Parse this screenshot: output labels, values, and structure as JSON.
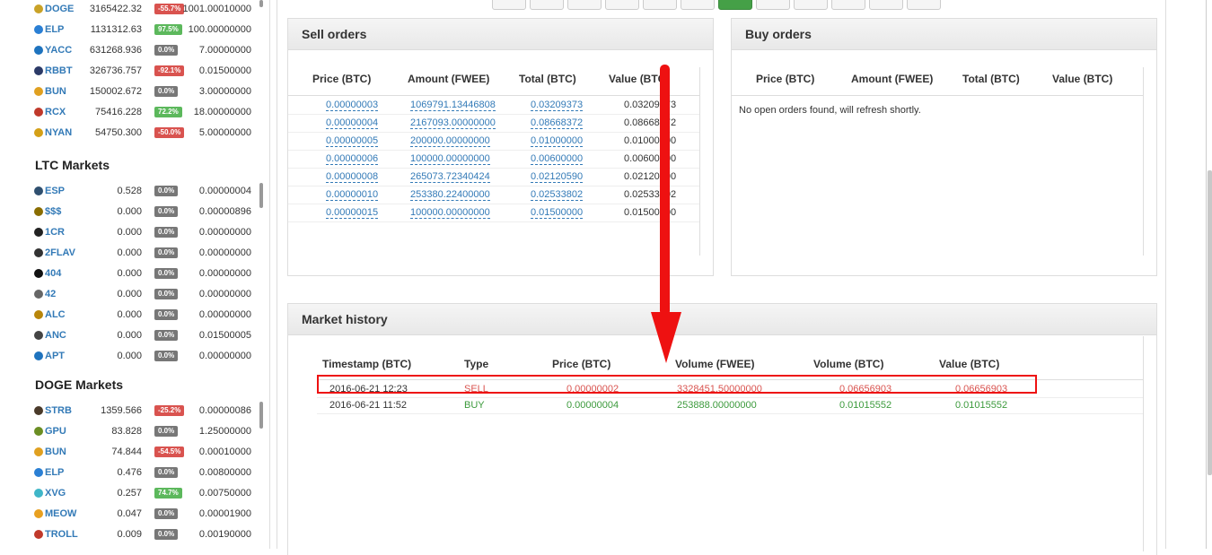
{
  "btc_markets": [
    {
      "symbol": "DOGE",
      "volume": "3165422.32",
      "change": "-55.7%",
      "change_color": "#d9534f",
      "price": "1001.00010000",
      "icon_color": "#c9a227"
    },
    {
      "symbol": "ELP",
      "volume": "1131312.63",
      "change": "97.5%",
      "change_color": "#5cb85c",
      "price": "100.00000000",
      "icon_color": "#2a7fd4"
    },
    {
      "symbol": "YACC",
      "volume": "631268.936",
      "change": "0.0%",
      "change_color": "#777777",
      "price": "7.00000000",
      "icon_color": "#1e73be"
    },
    {
      "symbol": "RBBT",
      "volume": "326736.757",
      "change": "-92.1%",
      "change_color": "#d9534f",
      "price": "0.01500000",
      "icon_color": "#2b3a67"
    },
    {
      "symbol": "BUN",
      "volume": "150002.672",
      "change": "0.0%",
      "change_color": "#777777",
      "price": "3.00000000",
      "icon_color": "#e0a020"
    },
    {
      "symbol": "RCX",
      "volume": "75416.228",
      "change": "72.2%",
      "change_color": "#5cb85c",
      "price": "18.00000000",
      "icon_color": "#c0392b"
    },
    {
      "symbol": "NYAN",
      "volume": "54750.300",
      "change": "-50.0%",
      "change_color": "#d9534f",
      "price": "5.00000000",
      "icon_color": "#d4a017"
    }
  ],
  "ltc_title": "LTC Markets",
  "ltc_markets": [
    {
      "symbol": "ESP",
      "volume": "0.528",
      "change": "0.0%",
      "change_color": "#777777",
      "price": "0.00000004",
      "icon_color": "#2f4f6f"
    },
    {
      "symbol": "$$$",
      "volume": "0.000",
      "change": "0.0%",
      "change_color": "#777777",
      "price": "0.00000896",
      "icon_color": "#8a6d00"
    },
    {
      "symbol": "1CR",
      "volume": "0.000",
      "change": "0.0%",
      "change_color": "#777777",
      "price": "0.00000000",
      "icon_color": "#222222"
    },
    {
      "symbol": "2FLAV",
      "volume": "0.000",
      "change": "0.0%",
      "change_color": "#777777",
      "price": "0.00000000",
      "icon_color": "#333333"
    },
    {
      "symbol": "404",
      "volume": "0.000",
      "change": "0.0%",
      "change_color": "#777777",
      "price": "0.00000000",
      "icon_color": "#111111"
    },
    {
      "symbol": "42",
      "volume": "0.000",
      "change": "0.0%",
      "change_color": "#777777",
      "price": "0.00000000",
      "icon_color": "#666666"
    },
    {
      "symbol": "ALC",
      "volume": "0.000",
      "change": "0.0%",
      "change_color": "#777777",
      "price": "0.00000000",
      "icon_color": "#b8860b"
    },
    {
      "symbol": "ANC",
      "volume": "0.000",
      "change": "0.0%",
      "change_color": "#777777",
      "price": "0.01500005",
      "icon_color": "#444444"
    },
    {
      "symbol": "APT",
      "volume": "0.000",
      "change": "0.0%",
      "change_color": "#777777",
      "price": "0.00000000",
      "icon_color": "#1e73be"
    }
  ],
  "doge_title": "DOGE Markets",
  "doge_markets": [
    {
      "symbol": "STRB",
      "volume": "1359.566",
      "change": "-25.2%",
      "change_color": "#d9534f",
      "price": "0.00000086",
      "icon_color": "#4a3a2a"
    },
    {
      "symbol": "GPU",
      "volume": "83.828",
      "change": "0.0%",
      "change_color": "#777777",
      "price": "1.25000000",
      "icon_color": "#6b8e23"
    },
    {
      "symbol": "BUN",
      "volume": "74.844",
      "change": "-54.5%",
      "change_color": "#d9534f",
      "price": "0.00010000",
      "icon_color": "#e0a020"
    },
    {
      "symbol": "ELP",
      "volume": "0.476",
      "change": "0.0%",
      "change_color": "#777777",
      "price": "0.00800000",
      "icon_color": "#2a7fd4"
    },
    {
      "symbol": "XVG",
      "volume": "0.257",
      "change": "74.7%",
      "change_color": "#5cb85c",
      "price": "0.00750000",
      "icon_color": "#3fb6c8"
    },
    {
      "symbol": "MEOW",
      "volume": "0.047",
      "change": "0.0%",
      "change_color": "#777777",
      "price": "0.00001900",
      "icon_color": "#e8a020"
    },
    {
      "symbol": "TROLL",
      "volume": "0.009",
      "change": "0.0%",
      "change_color": "#777777",
      "price": "0.00190000",
      "icon_color": "#c0392b"
    }
  ],
  "sell_orders": {
    "title": "Sell orders",
    "headers": [
      "Price (BTC)",
      "Amount (FWEE)",
      "Total (BTC)",
      "Value (BTC)"
    ],
    "rows": [
      [
        "0.00000003",
        "1069791.13446808",
        "0.03209373",
        "0.03209373"
      ],
      [
        "0.00000004",
        "2167093.00000000",
        "0.08668372",
        "0.08668372"
      ],
      [
        "0.00000005",
        "200000.00000000",
        "0.01000000",
        "0.01000000"
      ],
      [
        "0.00000006",
        "100000.00000000",
        "0.00600000",
        "0.00600000"
      ],
      [
        "0.00000008",
        "265073.72340424",
        "0.02120590",
        "0.02120590"
      ],
      [
        "0.00000010",
        "253380.22400000",
        "0.02533802",
        "0.02533802"
      ],
      [
        "0.00000015",
        "100000.00000000",
        "0.01500000",
        "0.01500000"
      ]
    ]
  },
  "buy_orders": {
    "title": "Buy orders",
    "headers": [
      "Price (BTC)",
      "Amount (FWEE)",
      "Total (BTC)",
      "Value (BTC)"
    ],
    "empty_message": "No open orders found, will refresh shortly."
  },
  "market_history": {
    "title": "Market history",
    "headers": [
      "Timestamp (BTC)",
      "Type",
      "Price (BTC)",
      "Volume (FWEE)",
      "Volume (BTC)",
      "Value (BTC)"
    ],
    "rows": [
      {
        "timestamp": "2016-06-21 12:23",
        "type": "SELL",
        "price": "0.00000002",
        "volume_fwee": "3328451.50000000",
        "volume_btc": "0.06656903",
        "value_btc": "0.06656903",
        "color": "#d9534f"
      },
      {
        "timestamp": "2016-06-21 11:52",
        "type": "BUY",
        "price": "0.00000004",
        "volume_fwee": "253888.00000000",
        "volume_btc": "0.01015552",
        "value_btc": "0.01015552",
        "color": "#3c9a3c"
      }
    ]
  },
  "annotation": {
    "color": "#ee1111"
  },
  "pagination": {
    "active_index": 6,
    "count": 12
  }
}
